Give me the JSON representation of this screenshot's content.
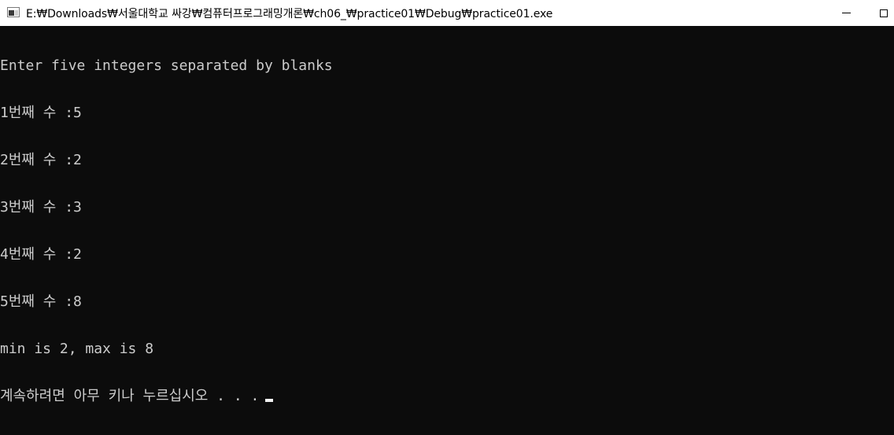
{
  "window": {
    "title": "E:₩Downloads₩서울대학교 싸강₩컴퓨터프로그래밍개론₩ch06_₩practice01₩Debug₩practice01.exe",
    "icon": "console-app-icon",
    "controls": {
      "minimize_icon": "minimize-icon",
      "maximize_icon": "maximize-icon"
    }
  },
  "console": {
    "background": "#0c0c0c",
    "foreground": "#cccccc",
    "lines": [
      "Enter five integers separated by blanks",
      "1번째 수 :5",
      "2번째 수 :2",
      "3번째 수 :3",
      "4번째 수 :2",
      "5번째 수 :8",
      "min is 2, max is 8",
      "계속하려면 아무 키나 누르십시오 . . ."
    ]
  }
}
